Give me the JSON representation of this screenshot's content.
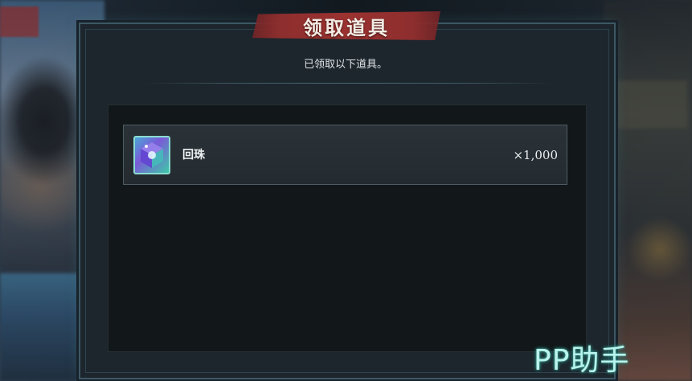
{
  "dialog": {
    "title": "领取道具",
    "subtitle": "已领取以下道具。"
  },
  "items": [
    {
      "name": "回珠",
      "quantity": "×1,000",
      "icon": "orb-crystal-icon"
    }
  ],
  "watermark": {
    "text": "PP助手"
  },
  "colors": {
    "title_banner": "#9a3230",
    "frame_accent": "#5b8e98",
    "panel_bg": "#121719",
    "row_bg": "#2a3238",
    "watermark": "#b9f3ec"
  }
}
